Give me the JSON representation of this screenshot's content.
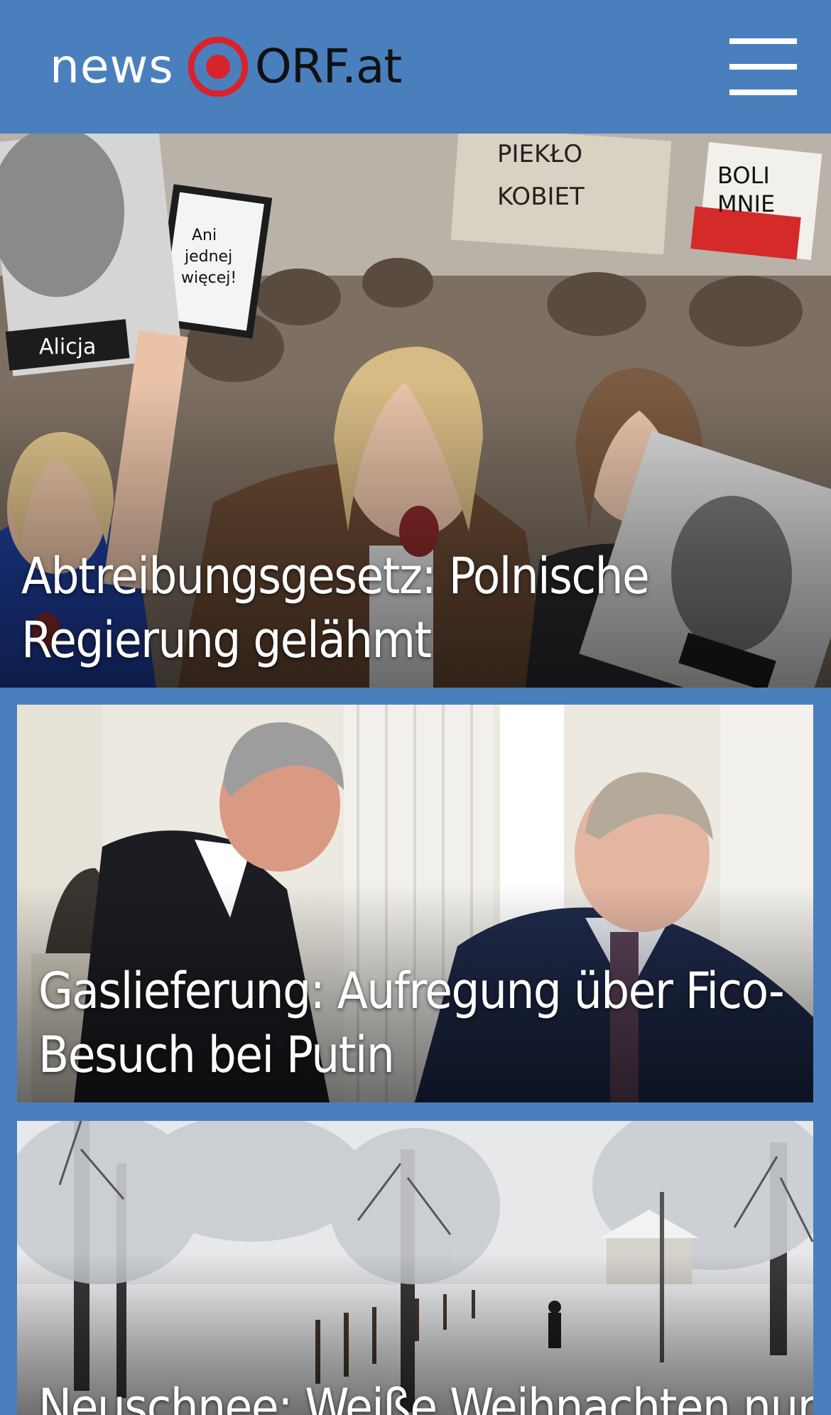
{
  "header": {
    "logo_prefix": "news",
    "logo_brand": "ORF.at",
    "logo_mark_icon": "orf-target-icon",
    "menu_icon": "hamburger-menu-icon",
    "brand_color": "#4a7fbd",
    "mark_color": "#d8232a"
  },
  "stories": [
    {
      "headline": "Abtreibungsgesetz: Polnische Regierung gelähmt",
      "image_alt": "protest-photo",
      "image_signs": [
        "Ani jednej więcej!",
        "PIEKŁO KOBIET",
        "BOLI MNIE POLSKA",
        "Alicja"
      ]
    },
    {
      "headline": "Gaslieferung: Aufregung über Fico-Besuch bei Putin",
      "image_alt": "meeting-photo"
    },
    {
      "headline": "Neuschnee: Weiße Weihnachten nur",
      "image_alt": "snow-landscape-photo"
    }
  ]
}
